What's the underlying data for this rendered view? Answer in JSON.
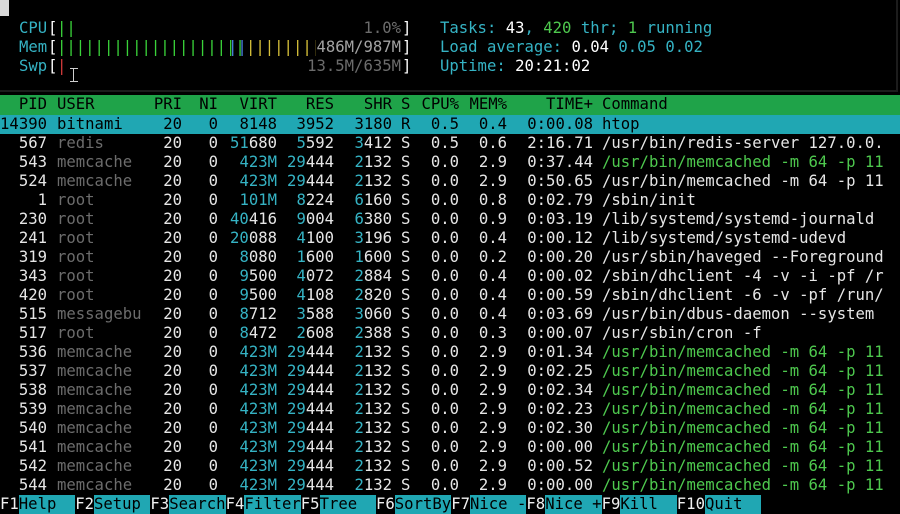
{
  "meters": {
    "cpu": {
      "label": "CPU",
      "open": "[",
      "bars": "||",
      "value": "1.0%",
      "close": "]"
    },
    "mem": {
      "label": "Mem",
      "open": "[",
      "bars_green": "|||||||||||||||||||||",
      "bars_blue": "||",
      "bars_yellow": "||||||||||",
      "value": "486M/987M",
      "close": "]"
    },
    "swp": {
      "label": "Swp",
      "open": "[",
      "bars": "|",
      "value": "13.5M/635M",
      "close": "]"
    }
  },
  "stats": {
    "tasks_label": "Tasks: ",
    "tasks": "43",
    "sep1": ", ",
    "threads": "420",
    "thr_label": " thr; ",
    "running": "1",
    "running_label": " running",
    "load_label": "Load average: ",
    "load1": "0.04",
    "load5": "0.05",
    "load15": "0.02",
    "uptime_label": "Uptime: ",
    "uptime": "20:21:02"
  },
  "header": {
    "pid": "PID",
    "user": "USER",
    "pri": "PRI",
    "ni": "NI",
    "virt": "VIRT",
    "res": "RES",
    "shr": "SHR",
    "s": "S",
    "cpu": "CPU%",
    "mem": "MEM%",
    "time": "TIME+",
    "command": "Command"
  },
  "processes": [
    {
      "pid": "14390",
      "user": "bitnami",
      "pri": "20",
      "ni": "0",
      "virt": "8148",
      "res": "3952",
      "shr": "3180",
      "s": "R",
      "cpu": "0.5",
      "mem": "0.4",
      "time": "0:00.08",
      "command": "htop",
      "selected": true,
      "thread": false
    },
    {
      "pid": "567",
      "user": "redis",
      "pri": "20",
      "ni": "0",
      "virt": "51680",
      "res": "5592",
      "shr": "3412",
      "s": "S",
      "cpu": "0.5",
      "mem": "0.6",
      "time": "2:16.71",
      "command": "/usr/bin/redis-server 127.0.0.",
      "selected": false,
      "thread": false
    },
    {
      "pid": "543",
      "user": "memcache",
      "pri": "20",
      "ni": "0",
      "virt": "423M",
      "res": "29444",
      "shr": "2132",
      "s": "S",
      "cpu": "0.0",
      "mem": "2.9",
      "time": "0:37.44",
      "command": "/usr/bin/memcached -m 64 -p 11",
      "selected": false,
      "thread": true
    },
    {
      "pid": "524",
      "user": "memcache",
      "pri": "20",
      "ni": "0",
      "virt": "423M",
      "res": "29444",
      "shr": "2132",
      "s": "S",
      "cpu": "0.0",
      "mem": "2.9",
      "time": "0:50.65",
      "command": "/usr/bin/memcached -m 64 -p 11",
      "selected": false,
      "thread": false
    },
    {
      "pid": "1",
      "user": "root",
      "pri": "20",
      "ni": "0",
      "virt": "101M",
      "res": "8224",
      "shr": "6160",
      "s": "S",
      "cpu": "0.0",
      "mem": "0.8",
      "time": "0:02.79",
      "command": "/sbin/init",
      "selected": false,
      "thread": false
    },
    {
      "pid": "230",
      "user": "root",
      "pri": "20",
      "ni": "0",
      "virt": "40416",
      "res": "9004",
      "shr": "6380",
      "s": "S",
      "cpu": "0.0",
      "mem": "0.9",
      "time": "0:03.19",
      "command": "/lib/systemd/systemd-journald",
      "selected": false,
      "thread": false
    },
    {
      "pid": "241",
      "user": "root",
      "pri": "20",
      "ni": "0",
      "virt": "20088",
      "res": "4100",
      "shr": "3196",
      "s": "S",
      "cpu": "0.0",
      "mem": "0.4",
      "time": "0:00.12",
      "command": "/lib/systemd/systemd-udevd",
      "selected": false,
      "thread": false
    },
    {
      "pid": "319",
      "user": "root",
      "pri": "20",
      "ni": "0",
      "virt": "8080",
      "res": "1600",
      "shr": "1600",
      "s": "S",
      "cpu": "0.0",
      "mem": "0.2",
      "time": "0:00.20",
      "command": "/usr/sbin/haveged --Foreground",
      "selected": false,
      "thread": false
    },
    {
      "pid": "343",
      "user": "root",
      "pri": "20",
      "ni": "0",
      "virt": "9500",
      "res": "4072",
      "shr": "2884",
      "s": "S",
      "cpu": "0.0",
      "mem": "0.4",
      "time": "0:00.02",
      "command": "/sbin/dhclient -4 -v -i -pf /r",
      "selected": false,
      "thread": false
    },
    {
      "pid": "420",
      "user": "root",
      "pri": "20",
      "ni": "0",
      "virt": "9500",
      "res": "4108",
      "shr": "2820",
      "s": "S",
      "cpu": "0.0",
      "mem": "0.4",
      "time": "0:00.59",
      "command": "/sbin/dhclient -6 -v -pf /run/",
      "selected": false,
      "thread": false
    },
    {
      "pid": "515",
      "user": "messagebu",
      "pri": "20",
      "ni": "0",
      "virt": "8712",
      "res": "3588",
      "shr": "3060",
      "s": "S",
      "cpu": "0.0",
      "mem": "0.4",
      "time": "0:03.69",
      "command": "/usr/bin/dbus-daemon --system",
      "selected": false,
      "thread": false
    },
    {
      "pid": "517",
      "user": "root",
      "pri": "20",
      "ni": "0",
      "virt": "8472",
      "res": "2608",
      "shr": "2388",
      "s": "S",
      "cpu": "0.0",
      "mem": "0.3",
      "time": "0:00.07",
      "command": "/usr/sbin/cron -f",
      "selected": false,
      "thread": false
    },
    {
      "pid": "536",
      "user": "memcache",
      "pri": "20",
      "ni": "0",
      "virt": "423M",
      "res": "29444",
      "shr": "2132",
      "s": "S",
      "cpu": "0.0",
      "mem": "2.9",
      "time": "0:01.34",
      "command": "/usr/bin/memcached -m 64 -p 11",
      "selected": false,
      "thread": true
    },
    {
      "pid": "537",
      "user": "memcache",
      "pri": "20",
      "ni": "0",
      "virt": "423M",
      "res": "29444",
      "shr": "2132",
      "s": "S",
      "cpu": "0.0",
      "mem": "2.9",
      "time": "0:02.25",
      "command": "/usr/bin/memcached -m 64 -p 11",
      "selected": false,
      "thread": true
    },
    {
      "pid": "538",
      "user": "memcache",
      "pri": "20",
      "ni": "0",
      "virt": "423M",
      "res": "29444",
      "shr": "2132",
      "s": "S",
      "cpu": "0.0",
      "mem": "2.9",
      "time": "0:02.34",
      "command": "/usr/bin/memcached -m 64 -p 11",
      "selected": false,
      "thread": true
    },
    {
      "pid": "539",
      "user": "memcache",
      "pri": "20",
      "ni": "0",
      "virt": "423M",
      "res": "29444",
      "shr": "2132",
      "s": "S",
      "cpu": "0.0",
      "mem": "2.9",
      "time": "0:02.23",
      "command": "/usr/bin/memcached -m 64 -p 11",
      "selected": false,
      "thread": true
    },
    {
      "pid": "540",
      "user": "memcache",
      "pri": "20",
      "ni": "0",
      "virt": "423M",
      "res": "29444",
      "shr": "2132",
      "s": "S",
      "cpu": "0.0",
      "mem": "2.9",
      "time": "0:02.30",
      "command": "/usr/bin/memcached -m 64 -p 11",
      "selected": false,
      "thread": true
    },
    {
      "pid": "541",
      "user": "memcache",
      "pri": "20",
      "ni": "0",
      "virt": "423M",
      "res": "29444",
      "shr": "2132",
      "s": "S",
      "cpu": "0.0",
      "mem": "2.9",
      "time": "0:00.00",
      "command": "/usr/bin/memcached -m 64 -p 11",
      "selected": false,
      "thread": true
    },
    {
      "pid": "542",
      "user": "memcache",
      "pri": "20",
      "ni": "0",
      "virt": "423M",
      "res": "29444",
      "shr": "2132",
      "s": "S",
      "cpu": "0.0",
      "mem": "2.9",
      "time": "0:00.52",
      "command": "/usr/bin/memcached -m 64 -p 11",
      "selected": false,
      "thread": true
    },
    {
      "pid": "544",
      "user": "memcache",
      "pri": "20",
      "ni": "0",
      "virt": "423M",
      "res": "29444",
      "shr": "2132",
      "s": "S",
      "cpu": "0.0",
      "mem": "2.9",
      "time": "0:00.00",
      "command": "/usr/bin/memcached -m 64 -p 11",
      "selected": false,
      "thread": true
    }
  ],
  "fkeys": [
    {
      "key": "F1",
      "label": "Help  "
    },
    {
      "key": "F2",
      "label": "Setup "
    },
    {
      "key": "F3",
      "label": "Search"
    },
    {
      "key": "F4",
      "label": "Filter"
    },
    {
      "key": "F5",
      "label": "Tree  "
    },
    {
      "key": "F6",
      "label": "SortBy"
    },
    {
      "key": "F7",
      "label": "Nice -"
    },
    {
      "key": "F8",
      "label": "Nice +"
    },
    {
      "key": "F9",
      "label": "Kill  "
    },
    {
      "key": "F10",
      "label": "Quit  "
    }
  ],
  "colors": {
    "header_bg": "#1fa349",
    "selected_bg": "#20a7b3",
    "thread_cmd": "#4ec94e",
    "meter_label": "#35b3c4",
    "user_grey": "#6c6c6c"
  }
}
